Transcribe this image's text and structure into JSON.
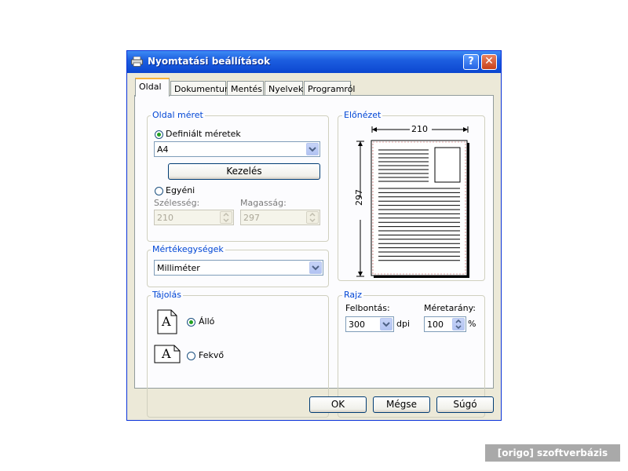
{
  "window": {
    "title": "Nyomtatási beállítások",
    "help_label": "?",
    "close_label": "✕"
  },
  "tabs": [
    {
      "label": "Oldal"
    },
    {
      "label": "Dokumentum"
    },
    {
      "label": "Mentés"
    },
    {
      "label": "Nyelvek"
    },
    {
      "label": "Programról"
    }
  ],
  "page_size": {
    "legend": "Oldal méret",
    "defined_label": "Definiált méretek",
    "defined_value": "A4",
    "manage_label": "Kezelés",
    "custom_label": "Egyéni",
    "width_label": "Szélesség:",
    "width_value": "210",
    "height_label": "Magasság:",
    "height_value": "297"
  },
  "units": {
    "legend": "Mértékegységek",
    "value": "Milliméter"
  },
  "orientation": {
    "legend": "Tájolás",
    "portrait_label": "Álló",
    "landscape_label": "Fekvő",
    "icon_letter": "A"
  },
  "preview": {
    "legend": "Előnézet",
    "width_label": "210",
    "height_label": "297"
  },
  "drawing": {
    "legend": "Rajz",
    "resolution_label": "Felbontás:",
    "resolution_value": "300",
    "resolution_unit": "dpi",
    "scale_label": "Méretarány:",
    "scale_value": "100",
    "scale_unit": "%"
  },
  "buttons": {
    "ok": "OK",
    "cancel": "Mégse",
    "help": "Súgó"
  },
  "watermark": "[origo] szoftverbázis",
  "colors": {
    "title_blue": "#0b46d0",
    "legend_blue": "#0046d5",
    "radio_green": "#21a121"
  }
}
